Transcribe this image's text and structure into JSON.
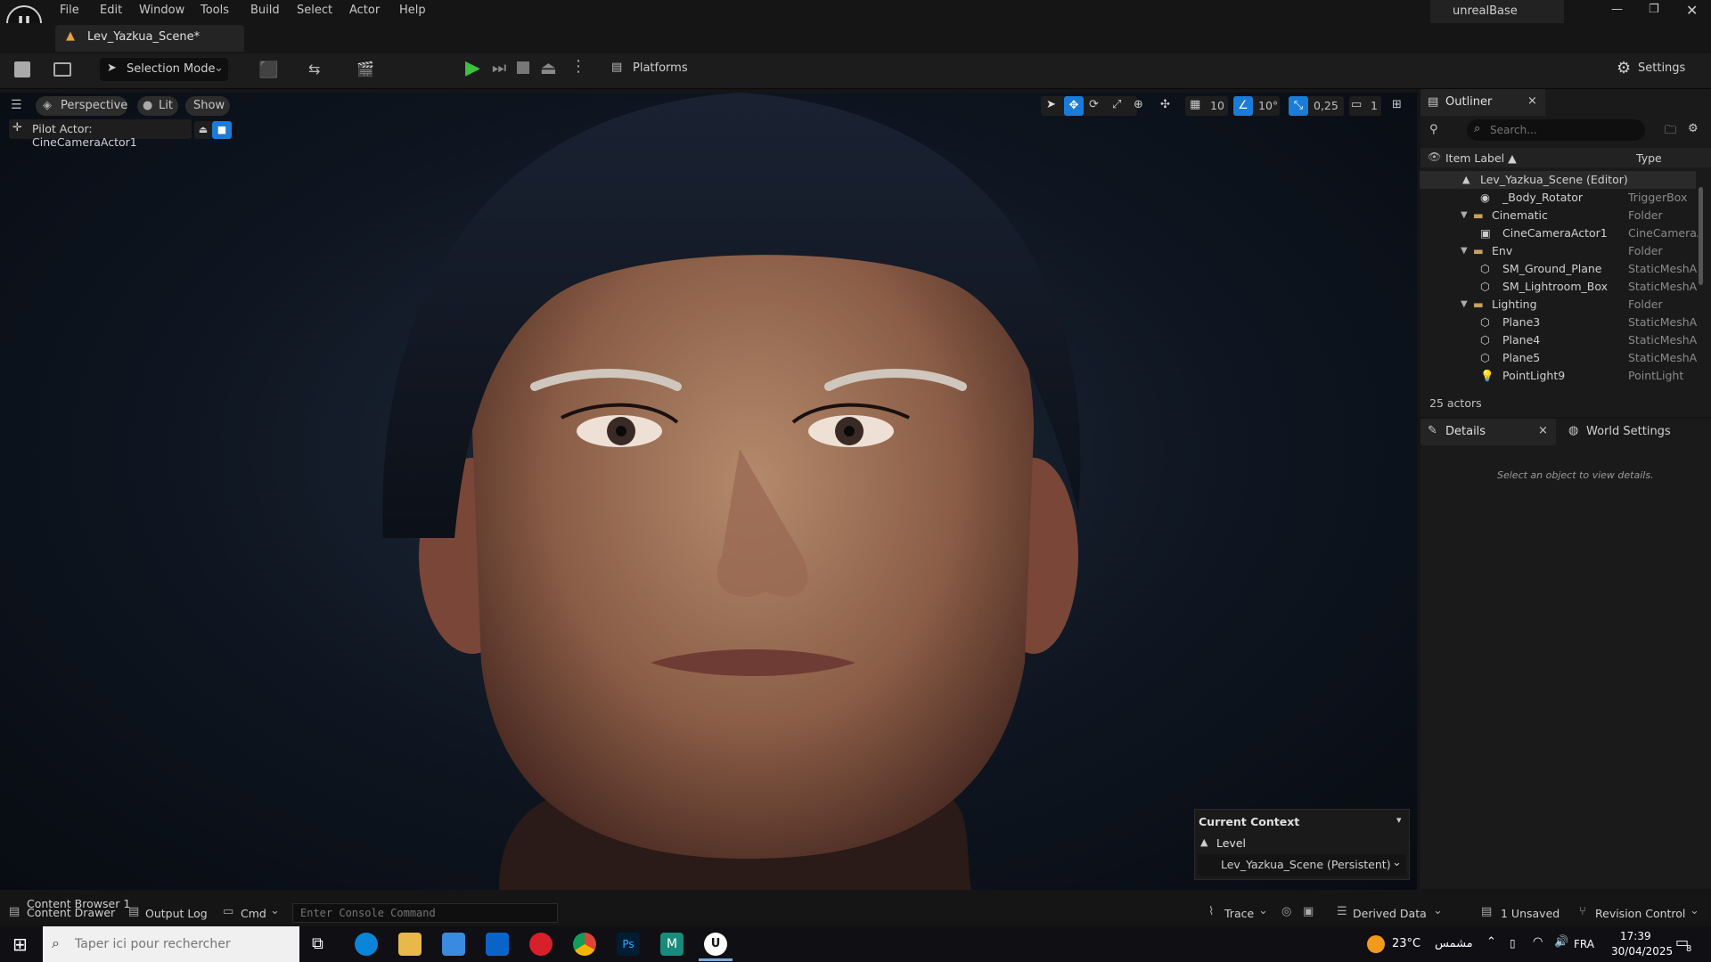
{
  "menu": [
    "File",
    "Edit",
    "Window",
    "Tools",
    "Build",
    "Select",
    "Actor",
    "Help"
  ],
  "project_name": "unrealBase",
  "level_tab": "Lev_Yazkua_Scene*",
  "toolbar": {
    "selection_mode": "Selection Mode",
    "platforms": "Platforms",
    "settings": "Settings"
  },
  "viewport": {
    "perspective": "Perspective",
    "lit": "Lit",
    "show": "Show",
    "pilot": "Pilot Actor: CineCameraActor1",
    "grid_snap": "10",
    "rot_snap": "10°",
    "scale_snap": "0,25",
    "camera_speed": "1"
  },
  "outliner": {
    "title": "Outliner",
    "search_placeholder": "Search...",
    "col_label": "Item Label ▲",
    "col_type": "Type",
    "rows": [
      {
        "label": "Lev_Yazkua_Scene (Editor)",
        "type": ""
      },
      {
        "label": "_Body_Rotator",
        "type": "TriggerBox"
      },
      {
        "label": "Cinematic",
        "type": "Folder"
      },
      {
        "label": "CineCameraActor1",
        "type": "CineCameraA"
      },
      {
        "label": "Env",
        "type": "Folder"
      },
      {
        "label": "SM_Ground_Plane",
        "type": "StaticMeshA"
      },
      {
        "label": "SM_Lightroom_Box",
        "type": "StaticMeshA"
      },
      {
        "label": "Lighting",
        "type": "Folder"
      },
      {
        "label": "Plane3",
        "type": "StaticMeshA"
      },
      {
        "label": "Plane4",
        "type": "StaticMeshA"
      },
      {
        "label": "Plane5",
        "type": "StaticMeshA"
      },
      {
        "label": "PointLight9",
        "type": "PointLight"
      }
    ],
    "actor_count": "25 actors"
  },
  "details": {
    "title": "Details",
    "world_settings": "World Settings",
    "empty_msg": "Select an object to view details."
  },
  "context": {
    "title": "Current Context",
    "level_label": "Level",
    "level_value": "Lev_Yazkua_Scene (Persistent)"
  },
  "bottom": {
    "content_browser": "Content Browser 1",
    "content_drawer": "Content Drawer",
    "output_log": "Output Log",
    "cmd": "Cmd",
    "console_placeholder": "Enter Console Command",
    "trace": "Trace",
    "derived_data": "Derived Data",
    "unsaved": "1 Unsaved",
    "revision_control": "Revision Control"
  },
  "taskbar": {
    "search_placeholder": "Taper ici pour rechercher",
    "weather": "23°C",
    "weather_text": "مشمس",
    "lang": "FRA",
    "time": "17:39",
    "date": "30/04/2025",
    "notif_count": "8"
  }
}
